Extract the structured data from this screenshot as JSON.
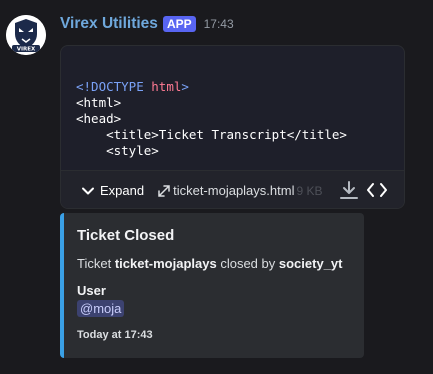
{
  "message": {
    "author": "Virex Utilities",
    "badge": "APP",
    "timestamp": "17:43",
    "avatar_text": "VIREX",
    "colors": {
      "author": "#6fa8dc",
      "badge": "#5865f2",
      "embed_accent": "#3aa0e6",
      "mention_bg": "#3c4270"
    }
  },
  "attachment": {
    "code_lines": {
      "line1_open": "<!DOCTYPE",
      "line1_kw": "html",
      "line1_close": ">",
      "line2": "<html>",
      "line3": "<head>",
      "line4_open": "<title>",
      "line4_text": "Ticket Transcript",
      "line4_close": "</title>",
      "line5": "<style>"
    },
    "expand_label": "Expand",
    "file_name": "ticket-mojaplays.html",
    "file_size": "9 KB",
    "icons": [
      "chevron-down-icon",
      "expand-arrows-icon",
      "download-icon",
      "code-icon"
    ]
  },
  "embed": {
    "title": "Ticket Closed",
    "description": {
      "prefix": "Ticket",
      "ticket_name": "ticket-mojaplays",
      "middle": "closed by",
      "closer": "society_yt"
    },
    "field_name": "User",
    "field_value": "@moja",
    "footer": "Today at 17:43"
  }
}
